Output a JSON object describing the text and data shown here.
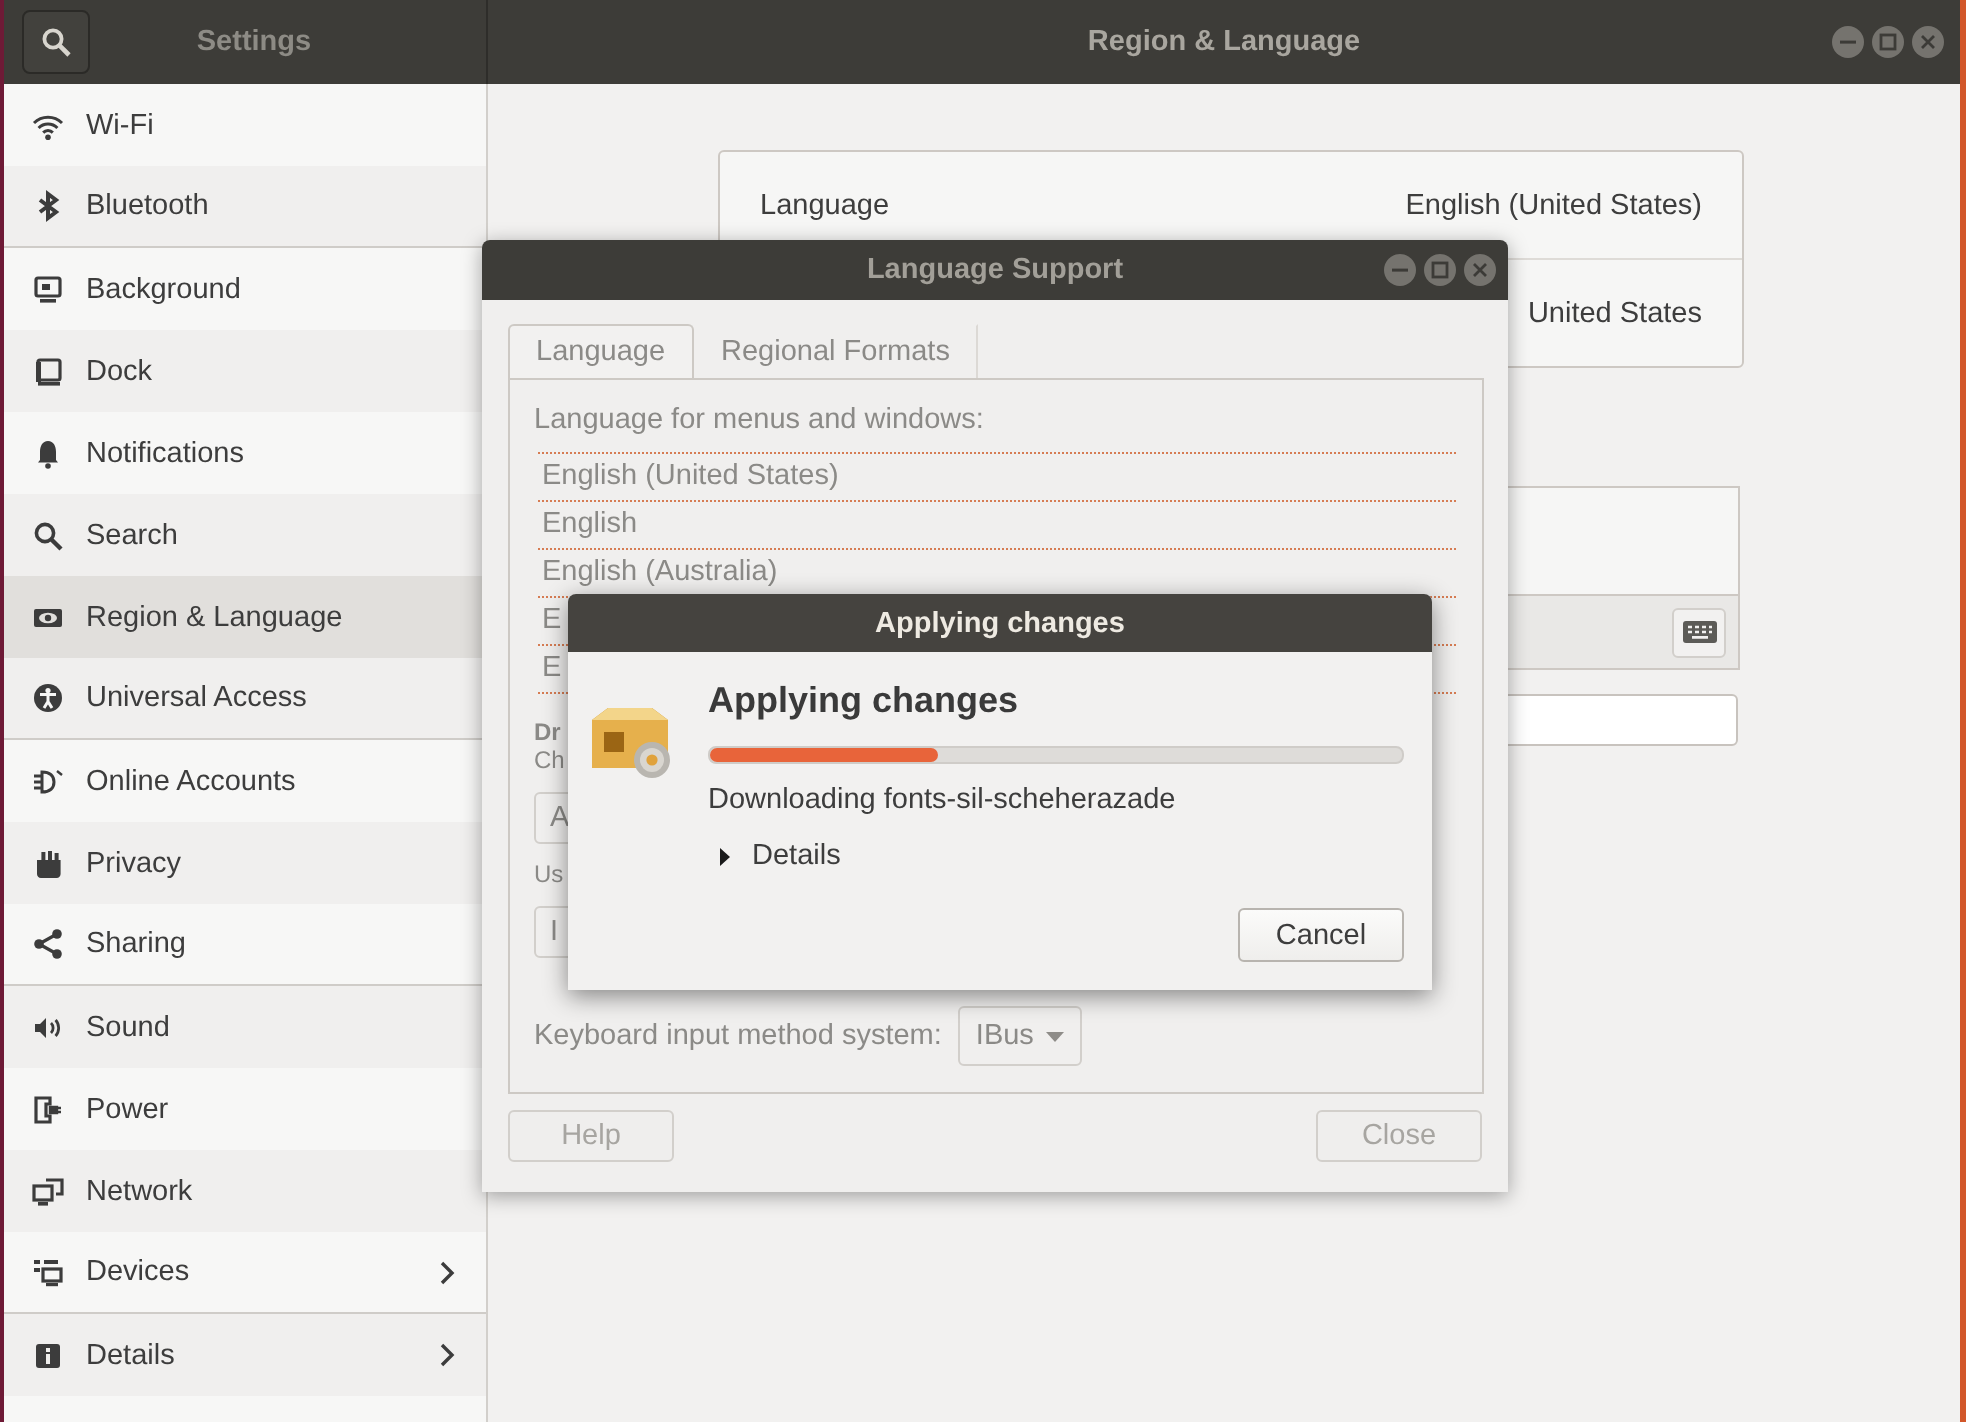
{
  "settings_window": {
    "sidebar_title": "Settings",
    "title": "Region & Language"
  },
  "sidebar": {
    "items": [
      {
        "label": "Wi-Fi",
        "selected": false,
        "divider_below": false,
        "submenu": false
      },
      {
        "label": "Bluetooth",
        "selected": false,
        "divider_below": true,
        "submenu": false
      },
      {
        "label": "Background",
        "selected": false,
        "divider_below": false,
        "submenu": false
      },
      {
        "label": "Dock",
        "selected": false,
        "divider_below": false,
        "submenu": false
      },
      {
        "label": "Notifications",
        "selected": false,
        "divider_below": false,
        "submenu": false
      },
      {
        "label": "Search",
        "selected": false,
        "divider_below": false,
        "submenu": false
      },
      {
        "label": "Region & Language",
        "selected": true,
        "divider_below": false,
        "submenu": false
      },
      {
        "label": "Universal Access",
        "selected": false,
        "divider_below": true,
        "submenu": false
      },
      {
        "label": "Online Accounts",
        "selected": false,
        "divider_below": false,
        "submenu": false
      },
      {
        "label": "Privacy",
        "selected": false,
        "divider_below": false,
        "submenu": false
      },
      {
        "label": "Sharing",
        "selected": false,
        "divider_below": true,
        "submenu": false
      },
      {
        "label": "Sound",
        "selected": false,
        "divider_below": false,
        "submenu": false
      },
      {
        "label": "Power",
        "selected": false,
        "divider_below": false,
        "submenu": false
      },
      {
        "label": "Network",
        "selected": false,
        "divider_below": false,
        "submenu": false
      },
      {
        "label": "Devices",
        "selected": false,
        "divider_below": true,
        "submenu": true
      },
      {
        "label": "Details",
        "selected": false,
        "divider_below": false,
        "submenu": true
      }
    ]
  },
  "region_panel": {
    "rows": [
      {
        "label": "Language",
        "value": "English (United States)"
      },
      {
        "value": "United States"
      }
    ]
  },
  "language_support": {
    "title": "Language Support",
    "tabs": [
      {
        "label": "Language",
        "selected": true
      },
      {
        "label": "Regional Formats",
        "selected": false
      }
    ],
    "list_label": "Language for menus and windows:",
    "languages": [
      "English (United States)",
      "English",
      "English (Australia)",
      "E",
      "E"
    ],
    "partial_texts": {
      "heading": "Dr",
      "subheading": "Ch",
      "field_1": "A",
      "label": "Us",
      "field_2": "I"
    },
    "input_method_label": "Keyboard input method system:",
    "input_method": "IBus",
    "buttons": [
      {
        "label": "Help",
        "disabled": true
      },
      {
        "label": "Close",
        "disabled": true
      }
    ]
  },
  "applying_changes": {
    "title": "Applying changes",
    "heading": "Applying changes",
    "level": 0.33,
    "status": "Downloading fonts-sil-scheherazade",
    "details": {
      "label": "Details",
      "expanded": false
    },
    "cancel": "Cancel"
  }
}
